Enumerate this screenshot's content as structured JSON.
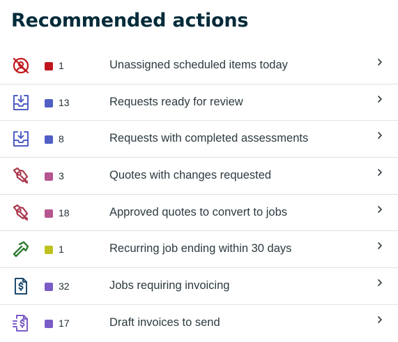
{
  "header": {
    "title": "Recommended actions"
  },
  "items": [
    {
      "icon": "unassigned-icon",
      "color": "#c0171c",
      "count": "1",
      "label": "Unassigned scheduled items today"
    },
    {
      "icon": "inbox-download-icon",
      "color": "#4f5fc4",
      "count": "13",
      "label": "Requests ready for review"
    },
    {
      "icon": "inbox-download-icon",
      "color": "#4f5fc4",
      "count": "8",
      "label": "Requests with completed assessments"
    },
    {
      "icon": "quote-icon",
      "color": "#b5568f",
      "count": "3",
      "label": "Quotes with changes requested"
    },
    {
      "icon": "quote-icon",
      "color": "#b5568f",
      "count": "18",
      "label": "Approved quotes to convert to jobs"
    },
    {
      "icon": "hammer-icon",
      "color": "#bfc11f",
      "count": "1",
      "label": "Recurring job ending within 30 days"
    },
    {
      "icon": "invoice-icon",
      "color": "#7b5cc7",
      "count": "32",
      "label": "Jobs requiring invoicing"
    },
    {
      "icon": "draft-invoice-icon",
      "color": "#7b5cc7",
      "count": "17",
      "label": "Draft invoices to send"
    }
  ]
}
